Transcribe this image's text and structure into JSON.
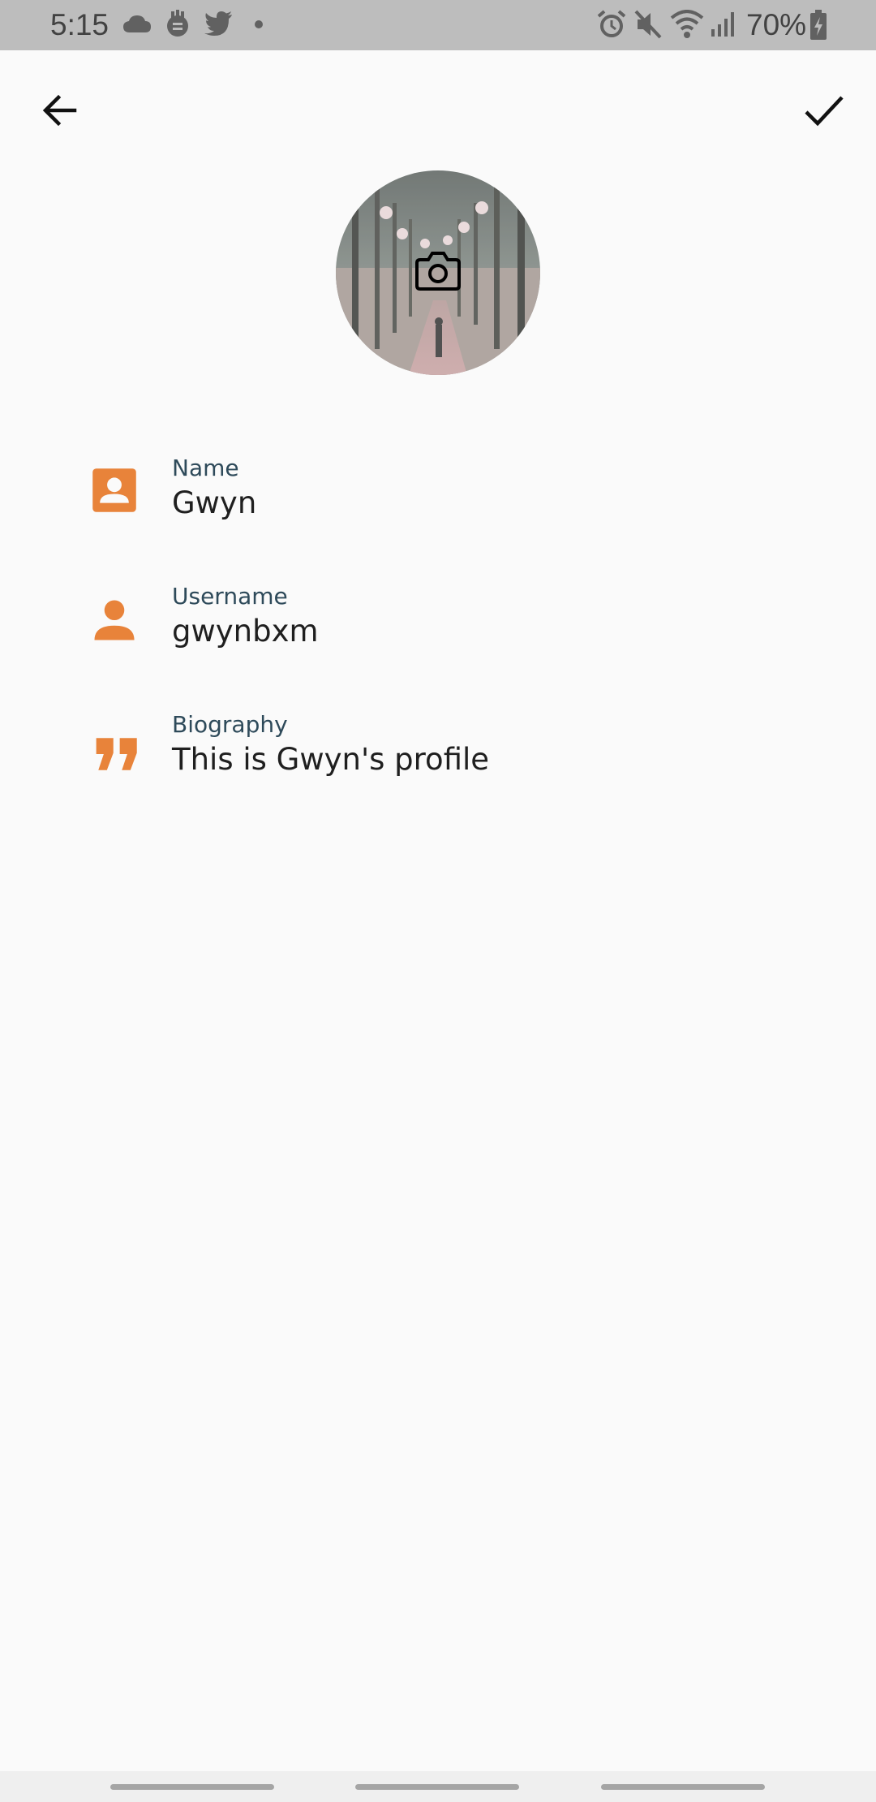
{
  "status_bar": {
    "time": "5:15",
    "battery_percent": "70%",
    "icons": [
      "cloud-icon",
      "app-icon",
      "twitter-icon",
      "dot-icon",
      "alarm-icon",
      "mute-icon",
      "wifi-icon",
      "signal-icon",
      "battery-icon"
    ]
  },
  "app_bar": {
    "back_icon": "arrow-left-icon",
    "save_icon": "check-icon"
  },
  "avatar": {
    "overlay_icon": "camera-icon"
  },
  "fields": [
    {
      "label": "Name",
      "value": "Gwyn",
      "icon": "contact-card-icon"
    },
    {
      "label": "Username",
      "value": "gwynbxm",
      "icon": "person-icon"
    },
    {
      "label": "Biography",
      "value": "This is Gwyn's profile",
      "icon": "quote-icon"
    }
  ],
  "colors": {
    "accent": "#e8833a",
    "label": "#2e4a5a",
    "value": "#1f1f1f",
    "background": "#fafafa",
    "status_bar": "#bdbdbd"
  }
}
